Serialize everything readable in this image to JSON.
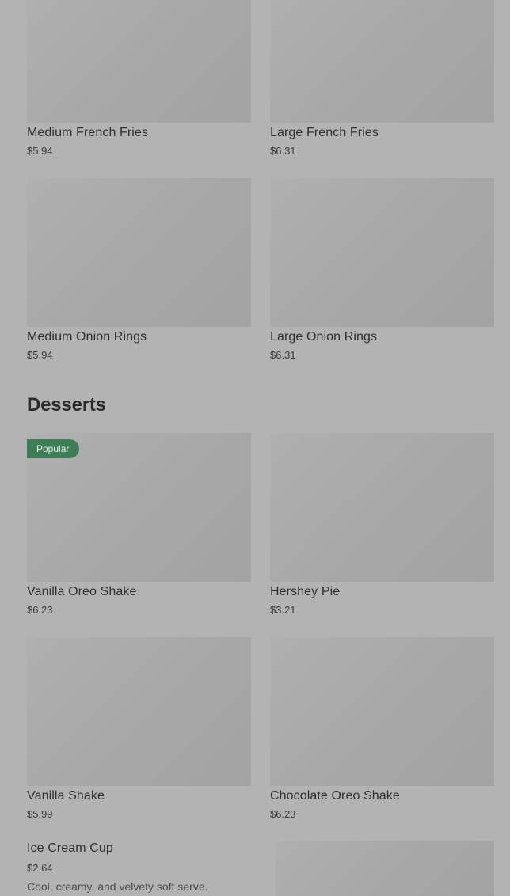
{
  "items": {
    "medium_french_fries": {
      "name": "Medium French Fries",
      "price": "$5.94"
    },
    "large_french_fries": {
      "name": "Large French Fries",
      "price": "$6.31"
    },
    "medium_onion_rings": {
      "name": "Medium Onion Rings",
      "price": "$5.94"
    },
    "large_onion_rings": {
      "name": "Large Onion Rings",
      "price": "$6.31"
    },
    "vanilla_oreo_shake": {
      "name": "Vanilla Oreo Shake",
      "price": "$6.23",
      "badge": "Popular"
    },
    "hershey_pie": {
      "name": "Hershey Pie",
      "price": "$3.21"
    },
    "vanilla_shake": {
      "name": "Vanilla Shake",
      "price": "$5.99"
    },
    "chocolate_oreo_shake": {
      "name": "Chocolate Oreo Shake",
      "price": "$6.23"
    },
    "ice_cream_cup": {
      "name": "Ice Cream Cup",
      "price": "$2.64",
      "description": "Cool, creamy, and velvety soft serve."
    }
  },
  "sections": {
    "desserts_title": "Desserts"
  },
  "colors": {
    "overlay_background": "#b3b3b3",
    "popular_badge": "#3e7d56"
  }
}
